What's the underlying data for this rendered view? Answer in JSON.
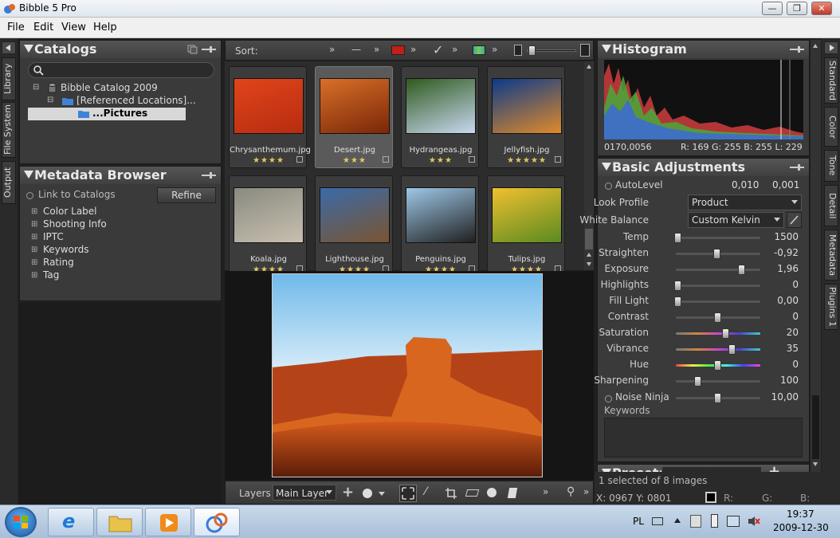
{
  "window": {
    "title": "Bibble 5 Pro"
  },
  "menu": [
    "File",
    "Edit",
    "View",
    "Help"
  ],
  "left_tabs": [
    "Library",
    "File System",
    "Output"
  ],
  "right_tabs": [
    "Standard",
    "Color",
    "Tone",
    "Detail",
    "Metadata",
    "Plugins 1"
  ],
  "catalogs": {
    "title": "Catalogs",
    "tree": [
      "Bibble Catalog 2009",
      "[Referenced Locations]...",
      "...Pictures"
    ]
  },
  "metadata_browser": {
    "title": "Metadata Browser",
    "link": "Link to Catalogs",
    "refine": "Refine",
    "items": [
      "Color Label",
      "Shooting Info",
      "IPTC",
      "Keywords",
      "Rating",
      "Tag"
    ]
  },
  "grid_toolbar": {
    "sort": "Sort:"
  },
  "thumbs": [
    {
      "name": "Chrysanthemum.jpg",
      "stars": "★★★★",
      "colors": [
        "#e0451b",
        "#b82c10"
      ]
    },
    {
      "name": "Desert.jpg",
      "stars": "★★★",
      "colors": [
        "#d87028",
        "#7a2608"
      ]
    },
    {
      "name": "Hydrangeas.jpg",
      "stars": "★★★",
      "colors": [
        "#2f5a1e",
        "#c8d8f0"
      ]
    },
    {
      "name": "Jellyfish.jpg",
      "stars": "★★★★★",
      "colors": [
        "#0b3a8a",
        "#e08a2a"
      ]
    },
    {
      "name": "Koala.jpg",
      "stars": "★★★★",
      "colors": [
        "#8a8a80",
        "#c8c0b0"
      ]
    },
    {
      "name": "Lighthouse.jpg",
      "stars": "★★★★",
      "colors": [
        "#3b6aa8",
        "#7a5530"
      ]
    },
    {
      "name": "Penguins.jpg",
      "stars": "★★★★",
      "colors": [
        "#9ec8e8",
        "#202020"
      ]
    },
    {
      "name": "Tulips.jpg",
      "stars": "★★★★",
      "colors": [
        "#f0c030",
        "#5a8a20"
      ]
    }
  ],
  "bottom_toolbar": {
    "layers": "Layers",
    "layer": "Main Layer"
  },
  "histogram": {
    "title": "Histogram",
    "coords": "0170,0056",
    "rgb": "R: 169  G: 255  B: 255  L: 229"
  },
  "basic": {
    "title": "Basic Adjustments",
    "autolevel": {
      "label": "AutoLevel",
      "v1": "0,010",
      "v2": "0,001"
    },
    "look_profile": {
      "label": "Look Profile",
      "value": "Product"
    },
    "white_balance": {
      "label": "White Balance",
      "value": "Custom Kelvin"
    },
    "sliders": [
      {
        "label": "Temp",
        "value": "1500",
        "pos": 0.0,
        "track": "#555"
      },
      {
        "label": "Straighten",
        "value": "-0,92",
        "pos": 0.49,
        "track": "#555"
      },
      {
        "label": "Exposure",
        "value": "1,96",
        "pos": 0.8,
        "track": "#555"
      },
      {
        "label": "Highlights",
        "value": "0",
        "pos": 0.0,
        "track": "#555"
      },
      {
        "label": "Fill Light",
        "value": "0,00",
        "pos": 0.0,
        "track": "#555"
      },
      {
        "label": "Contrast",
        "value": "0",
        "pos": 0.5,
        "track": "#555"
      },
      {
        "label": "Saturation",
        "value": "20",
        "pos": 0.6,
        "track": "grad1"
      },
      {
        "label": "Vibrance",
        "value": "35",
        "pos": 0.68,
        "track": "grad1"
      },
      {
        "label": "Hue",
        "value": "0",
        "pos": 0.5,
        "track": "grad2"
      },
      {
        "label": "Sharpening",
        "value": "100",
        "pos": 0.25,
        "track": "#555"
      },
      {
        "label": "Noise Ninja",
        "value": "10,00",
        "pos": 0.5,
        "track": "#555"
      }
    ],
    "keywords": "Keywords"
  },
  "presets": {
    "title": "Presets"
  },
  "status": {
    "selected": "1 selected of 8 images",
    "xy": "X: 0967  Y: 0801",
    "r": "R:",
    "g": "G:",
    "b": "B:"
  },
  "tray": {
    "lang": "PL",
    "time": "19:37",
    "date": "2009-12-30"
  }
}
